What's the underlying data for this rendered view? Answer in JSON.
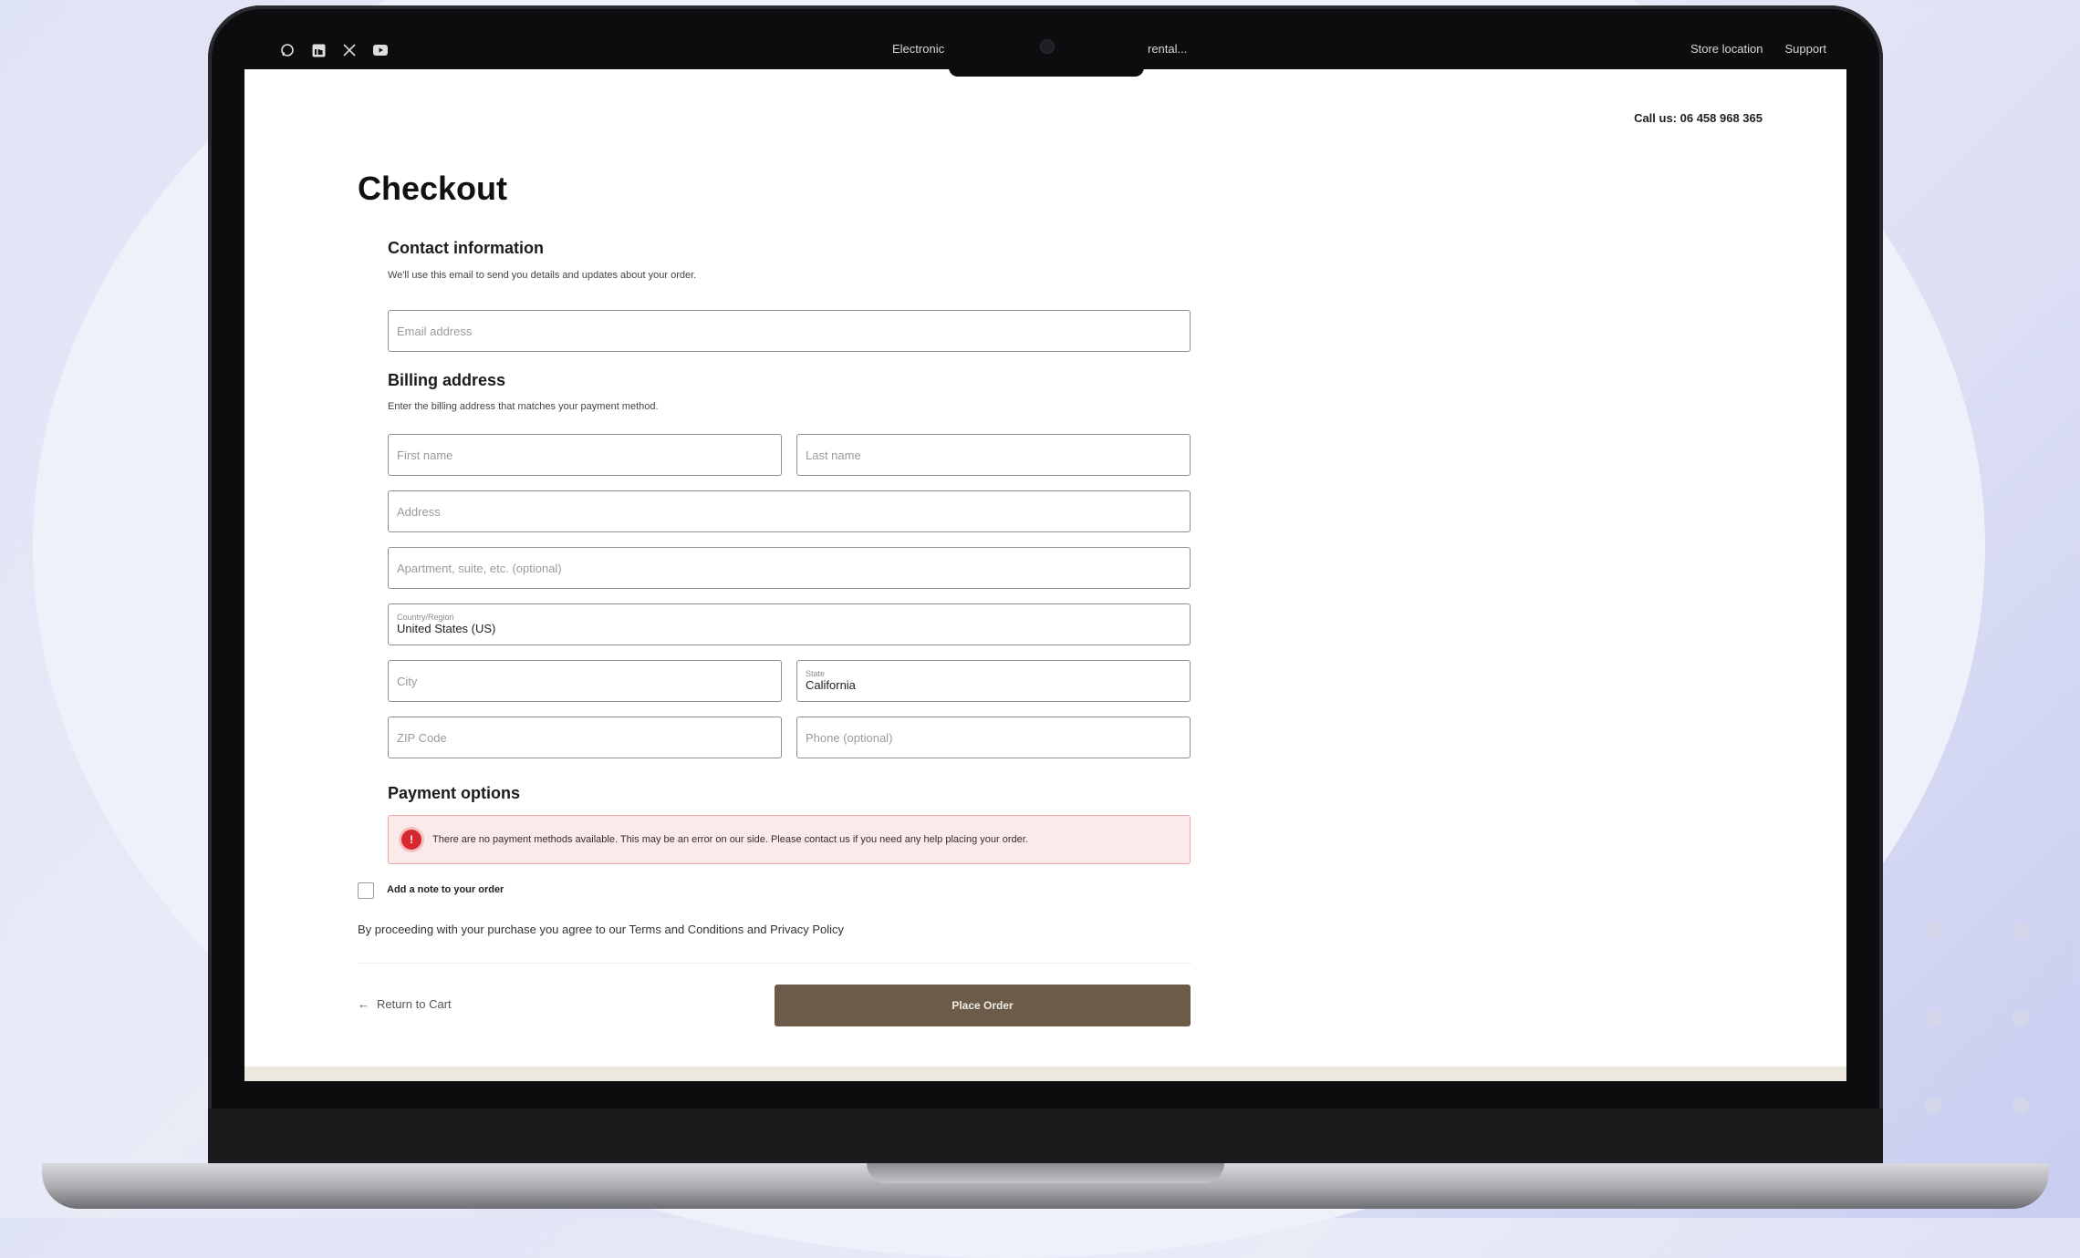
{
  "browser_bar": {
    "social_icons": [
      "whatsapp-icon",
      "linkedin-icon",
      "x-icon",
      "youtube-icon"
    ],
    "center_left": "Electronic",
    "center_right": "rental...",
    "right_links": [
      "Store location",
      "Support"
    ]
  },
  "header": {
    "call": "Call us: 06 458 968 365"
  },
  "page": {
    "title": "Checkout"
  },
  "contact": {
    "heading": "Contact information",
    "desc": "We'll use this email to send you details and updates about your order.",
    "email_placeholder": "Email address"
  },
  "billing": {
    "heading": "Billing address",
    "desc": "Enter the billing address that matches your payment method.",
    "first_name": "First name",
    "last_name": "Last name",
    "address": "Address",
    "apartment": "Apartment, suite, etc. (optional)",
    "country_label": "Country/Region",
    "country_value": "United States (US)",
    "city": "City",
    "state_label": "State",
    "state_value": "California",
    "zip": "ZIP Code",
    "phone": "Phone (optional)"
  },
  "payment": {
    "heading": "Payment options",
    "notice": "There are no payment methods available. This may be an error on our side. Please contact us if you need any help placing your order.",
    "notice_icon": "!"
  },
  "note": {
    "label": "Add a note to your order"
  },
  "terms": "By proceeding with your purchase you agree to our Terms and Conditions and Privacy Policy",
  "actions": {
    "return_arrow": "←",
    "return": "Return to Cart",
    "place_order": "Place Order"
  },
  "colors": {
    "place_order_bg": "#6b5b48",
    "error": "#d7282f"
  }
}
